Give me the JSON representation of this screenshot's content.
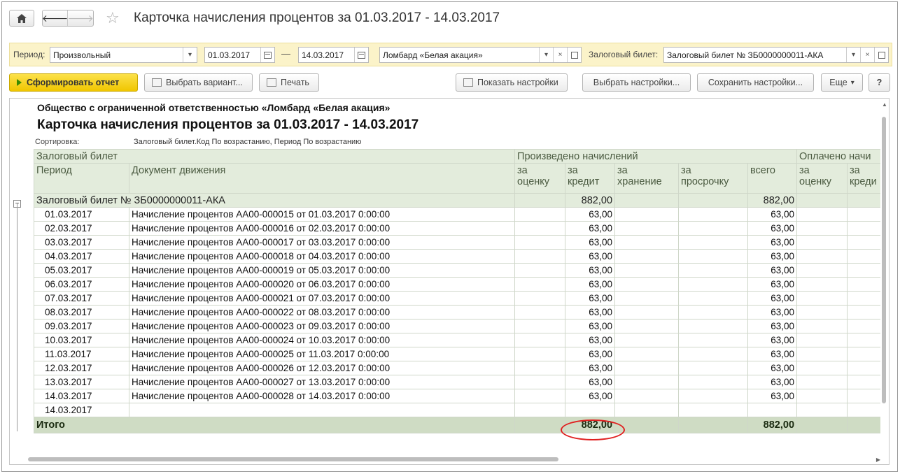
{
  "window": {
    "title": "Карточка начисления процентов за 01.03.2017 - 14.03.2017"
  },
  "filters": {
    "period_label": "Период:",
    "period_value": "Произвольный",
    "date_from": "01.03.2017",
    "dash": "—",
    "date_to": "14.03.2017",
    "organization": "Ломбард «Белая акация»",
    "ticket_label": "Залоговый билет:",
    "ticket_value": "Залоговый билет № ЗБ0000000011-АКА"
  },
  "toolbar": {
    "generate": "Сформировать отчет",
    "choose_variant": "Выбрать вариант...",
    "print": "Печать",
    "show_settings": "Показать настройки",
    "choose_settings": "Выбрать настройки...",
    "save_settings": "Сохранить настройки...",
    "more": "Еще",
    "help": "?"
  },
  "report": {
    "organization": "Общество с ограниченной ответственностью «Ломбард «Белая акация»",
    "title": "Карточка начисления процентов за 01.03.2017 - 14.03.2017",
    "sort_label": "Сортировка:",
    "sort_value": "Залоговый билет.Код По возрастанию, Период По возрастанию",
    "headers": {
      "ticket": "Залоговый билет",
      "accrued": "Произведено начислений",
      "paid": "Оплачено начи",
      "period": "Период",
      "document": "Документ движения",
      "col_eval_1": "за",
      "col_eval_2": "оценку",
      "col_credit_1": "за",
      "col_credit_2": "кредит",
      "col_storage_1": "за",
      "col_storage_2": "хранение",
      "col_overdue_1": "за",
      "col_overdue_2": "просрочку",
      "col_total": "всего",
      "col_paid_eval_1": "за",
      "col_paid_eval_2": "оценку",
      "col_paid_credit_1": "за",
      "col_paid_credit_2": "креди"
    },
    "group": {
      "label": "Залоговый билет № ЗБ0000000011-АКА",
      "credit": "882,00",
      "total": "882,00"
    },
    "rows": [
      {
        "period": "01.03.2017",
        "doc": "Начисление процентов АА00-000015 от 01.03.2017 0:00:00",
        "credit": "63,00",
        "total": "63,00"
      },
      {
        "period": "02.03.2017",
        "doc": "Начисление процентов АА00-000016 от 02.03.2017 0:00:00",
        "credit": "63,00",
        "total": "63,00"
      },
      {
        "period": "03.03.2017",
        "doc": "Начисление процентов АА00-000017 от 03.03.2017 0:00:00",
        "credit": "63,00",
        "total": "63,00"
      },
      {
        "period": "04.03.2017",
        "doc": "Начисление процентов АА00-000018 от 04.03.2017 0:00:00",
        "credit": "63,00",
        "total": "63,00"
      },
      {
        "period": "05.03.2017",
        "doc": "Начисление процентов АА00-000019 от 05.03.2017 0:00:00",
        "credit": "63,00",
        "total": "63,00"
      },
      {
        "period": "06.03.2017",
        "doc": "Начисление процентов АА00-000020 от 06.03.2017 0:00:00",
        "credit": "63,00",
        "total": "63,00"
      },
      {
        "period": "07.03.2017",
        "doc": "Начисление процентов АА00-000021 от 07.03.2017 0:00:00",
        "credit": "63,00",
        "total": "63,00"
      },
      {
        "period": "08.03.2017",
        "doc": "Начисление процентов АА00-000022 от 08.03.2017 0:00:00",
        "credit": "63,00",
        "total": "63,00"
      },
      {
        "period": "09.03.2017",
        "doc": "Начисление процентов АА00-000023 от 09.03.2017 0:00:00",
        "credit": "63,00",
        "total": "63,00"
      },
      {
        "period": "10.03.2017",
        "doc": "Начисление процентов АА00-000024 от 10.03.2017 0:00:00",
        "credit": "63,00",
        "total": "63,00"
      },
      {
        "period": "11.03.2017",
        "doc": "Начисление процентов АА00-000025 от 11.03.2017 0:00:00",
        "credit": "63,00",
        "total": "63,00"
      },
      {
        "period": "12.03.2017",
        "doc": "Начисление процентов АА00-000026 от 12.03.2017 0:00:00",
        "credit": "63,00",
        "total": "63,00"
      },
      {
        "period": "13.03.2017",
        "doc": "Начисление процентов АА00-000027 от 13.03.2017 0:00:00",
        "credit": "63,00",
        "total": "63,00"
      },
      {
        "period": "14.03.2017",
        "doc": "Начисление процентов АА00-000028 от 14.03.2017 0:00:00",
        "credit": "63,00",
        "total": "63,00"
      },
      {
        "period": "14.03.2017",
        "doc": "",
        "credit": "",
        "total": ""
      }
    ],
    "total_row": {
      "label": "Итого",
      "credit": "882,00",
      "total": "882,00"
    }
  },
  "colors": {
    "header_bg": "#e3ecdc",
    "total_bg": "#cfdcc4",
    "filter_bg": "#fbf3c9",
    "primary_button": "#f0c600",
    "highlight": "#e02020"
  }
}
